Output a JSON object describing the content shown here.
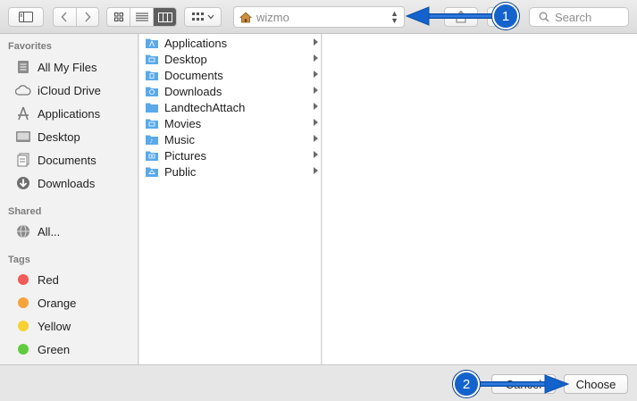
{
  "toolbar": {
    "path_folder": "wizmo",
    "search_placeholder": "Search"
  },
  "sidebar": {
    "sections": [
      {
        "title": "Favorites",
        "items": [
          {
            "label": "All My Files",
            "icon": "all-files-icon"
          },
          {
            "label": "iCloud Drive",
            "icon": "cloud-icon"
          },
          {
            "label": "Applications",
            "icon": "applications-icon"
          },
          {
            "label": "Desktop",
            "icon": "desktop-icon"
          },
          {
            "label": "Documents",
            "icon": "documents-icon"
          },
          {
            "label": "Downloads",
            "icon": "download-icon"
          }
        ]
      },
      {
        "title": "Shared",
        "items": [
          {
            "label": "All...",
            "icon": "network-icon"
          }
        ]
      },
      {
        "title": "Tags",
        "items": [
          {
            "label": "Red",
            "color": "#f25b57"
          },
          {
            "label": "Orange",
            "color": "#f6a33a"
          },
          {
            "label": "Yellow",
            "color": "#f7d130"
          },
          {
            "label": "Green",
            "color": "#5fcc3f"
          }
        ]
      }
    ]
  },
  "column1": {
    "folders": [
      "Applications",
      "Desktop",
      "Documents",
      "Downloads",
      "LandtechAttach",
      "Movies",
      "Music",
      "Pictures",
      "Public"
    ]
  },
  "footer": {
    "cancel_label": "Cancel",
    "choose_label": "Choose"
  },
  "annotations": [
    {
      "number": "1"
    },
    {
      "number": "2"
    }
  ],
  "colors": {
    "folder": "#5aa9ea",
    "selected_view": "#5e5e5e",
    "callout": "#1463cc"
  }
}
